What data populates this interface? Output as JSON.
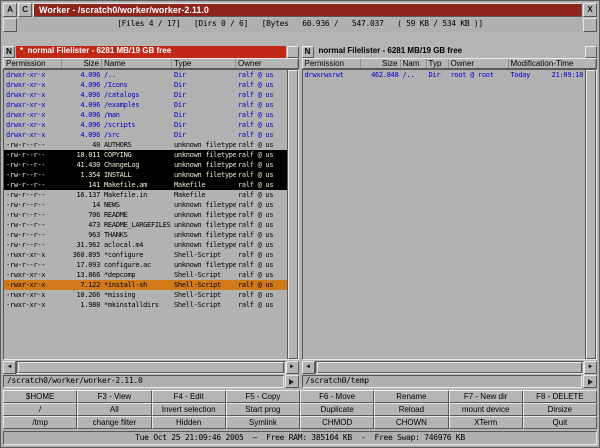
{
  "window": {
    "title": "Worker - /scratch0/worker/worker-2.11.0",
    "wm_buttons": {
      "left1": "A",
      "left2": "C",
      "close": "X"
    }
  },
  "global_status": "[Files 4 / 17]   [Dirs 0 / 6]   [Bytes   60.936 /   547.037   ( 59 KB / 534 KB )]",
  "left_panel": {
    "header": {
      "mode": "N",
      "title": "*  normal Filelister - 6281 MB/19 GB free"
    },
    "columns": [
      "Permission",
      "Size",
      "Name",
      "Type",
      "Owner"
    ],
    "path": "/scratch0/worker/worker-2.11.0",
    "rows": [
      {
        "perm": "drwxr-xr-x",
        "size": "4.096",
        "name": "/..",
        "type": "Dir",
        "owner": "ralf @ us",
        "kind": "dir",
        "state": "normal"
      },
      {
        "perm": "drwxr-xr-x",
        "size": "4.096",
        "name": "/Icons",
        "type": "Dir",
        "owner": "ralf @ us",
        "kind": "dir",
        "state": "normal"
      },
      {
        "perm": "drwxr-xr-x",
        "size": "4.096",
        "name": "/catalogs",
        "type": "Dir",
        "owner": "ralf @ us",
        "kind": "dir",
        "state": "normal"
      },
      {
        "perm": "drwxr-xr-x",
        "size": "4.096",
        "name": "/examples",
        "type": "Dir",
        "owner": "ralf @ us",
        "kind": "dir",
        "state": "normal"
      },
      {
        "perm": "drwxr-xr-x",
        "size": "4.096",
        "name": "/man",
        "type": "Dir",
        "owner": "ralf @ us",
        "kind": "dir",
        "state": "normal"
      },
      {
        "perm": "drwxr-xr-x",
        "size": "4.096",
        "name": "/scripts",
        "type": "Dir",
        "owner": "ralf @ us",
        "kind": "dir",
        "state": "normal"
      },
      {
        "perm": "drwxr-xr-x",
        "size": "4.096",
        "name": "/src",
        "type": "Dir",
        "owner": "ralf @ us",
        "kind": "dir",
        "state": "normal"
      },
      {
        "perm": "-rw-r--r--",
        "size": "40",
        "name": "AUTHORS",
        "type": "unknown filetype",
        "owner": "ralf @ us",
        "kind": "file",
        "state": "normal"
      },
      {
        "perm": "-rw-r--r--",
        "size": "18.011",
        "name": "COPYING",
        "type": "unknown filetype",
        "owner": "ralf @ us",
        "kind": "file",
        "state": "selected"
      },
      {
        "perm": "-rw-r--r--",
        "size": "41.430",
        "name": "ChangeLog",
        "type": "unknown filetype",
        "owner": "ralf @ us",
        "kind": "file",
        "state": "selected"
      },
      {
        "perm": "-rw-r--r--",
        "size": "1.354",
        "name": "INSTALL",
        "type": "unknown filetype",
        "owner": "ralf @ us",
        "kind": "file",
        "state": "selected"
      },
      {
        "perm": "-rw-r--r--",
        "size": "141",
        "name": "Makefile.am",
        "type": "Makefile",
        "owner": "ralf @ us",
        "kind": "file",
        "state": "selected"
      },
      {
        "perm": "-rw-r--r--",
        "size": "16.137",
        "name": "Makefile.in",
        "type": "Makefile",
        "owner": "ralf @ us",
        "kind": "file",
        "state": "normal"
      },
      {
        "perm": "-rw-r--r--",
        "size": "14",
        "name": "NEWS",
        "type": "unknown filetype",
        "owner": "ralf @ us",
        "kind": "file",
        "state": "normal"
      },
      {
        "perm": "-rw-r--r--",
        "size": "706",
        "name": "README",
        "type": "unknown filetype",
        "owner": "ralf @ us",
        "kind": "file",
        "state": "normal"
      },
      {
        "perm": "-rw-r--r--",
        "size": "473",
        "name": "README_LARGEFILES",
        "type": "unknown filetype",
        "owner": "ralf @ us",
        "kind": "file",
        "state": "normal"
      },
      {
        "perm": "-rw-r--r--",
        "size": "963",
        "name": "THANKS",
        "type": "unknown filetype",
        "owner": "ralf @ us",
        "kind": "file",
        "state": "normal"
      },
      {
        "perm": "-rw-r--r--",
        "size": "31.962",
        "name": "aclocal.m4",
        "type": "unknown filetype",
        "owner": "ralf @ us",
        "kind": "file",
        "state": "normal"
      },
      {
        "perm": "-rwxr-xr-x",
        "size": "360.895",
        "name": "*configure",
        "type": "Shell-Script",
        "owner": "ralf @ us",
        "kind": "file",
        "state": "normal"
      },
      {
        "perm": "-rw-r--r--",
        "size": "17.093",
        "name": "configure.ac",
        "type": "unknown filetype",
        "owner": "ralf @ us",
        "kind": "file",
        "state": "normal"
      },
      {
        "perm": "-rwxr-xr-x",
        "size": "13.866",
        "name": "*depcomp",
        "type": "Shell-Script",
        "owner": "ralf @ us",
        "kind": "file",
        "state": "normal"
      },
      {
        "perm": "-rwxr-xr-x",
        "size": "7.122",
        "name": "*install-sh",
        "type": "Shell-Script",
        "owner": "ralf @ us",
        "kind": "file",
        "state": "cursor"
      },
      {
        "perm": "-rwxr-xr-x",
        "size": "10.266",
        "name": "*missing",
        "type": "Shell-Script",
        "owner": "ralf @ us",
        "kind": "file",
        "state": "normal"
      },
      {
        "perm": "-rwxr-xr-x",
        "size": "1.988",
        "name": "*mkinstalldirs",
        "type": "Shell-Script",
        "owner": "ralf @ us",
        "kind": "file",
        "state": "normal"
      }
    ]
  },
  "right_panel": {
    "header": {
      "mode": "N",
      "title": "normal Filelister - 6281 MB/19 GB free"
    },
    "columns": [
      "Permission",
      "Size",
      "Nam",
      "Typ",
      "Owner",
      "Modification-Time"
    ],
    "path": "/scratch0/temp",
    "rows": [
      {
        "perm": "drwxrwxrwt",
        "size": "462.848",
        "name": "/..",
        "type": "Dir",
        "owner": "root @ root",
        "mtime_day": "Today",
        "mtime_time": "21:09:18",
        "kind": "dir",
        "state": "normal"
      }
    ]
  },
  "button_bank": [
    [
      "$HOME",
      "F3 - View",
      "F4 - Edit",
      "F5 - Copy",
      "F6 - Move",
      "Rename",
      "F7 - New dir",
      "F8 - DELETE"
    ],
    [
      "/",
      "All",
      "Invert selection",
      "Start prog",
      "Duplicate",
      "Reload",
      "mount device",
      "Dirsize"
    ],
    [
      "/tmp",
      "change filter",
      "Hidden",
      "Symlink",
      "CHMOD",
      "CHOWN",
      "XTerm",
      "Quit"
    ]
  ],
  "clock_status": "Tue Oct 25 21:09:46 2005  —  Free RAM: 385104 KB  -  Free Swap: 746976 KB",
  "icons": {
    "close": "X",
    "scroll_left": "◄",
    "scroll_right": "►",
    "path_menu": "right-triangle"
  },
  "colors": {
    "titlebar": "#8e241c",
    "active_header": "#c22818",
    "dir_text": "#0000c4",
    "selected_bg": "#000000",
    "selected_text": "#f0ead2",
    "cursor_bg": "#d2791c",
    "background": "#b5b5b5"
  }
}
